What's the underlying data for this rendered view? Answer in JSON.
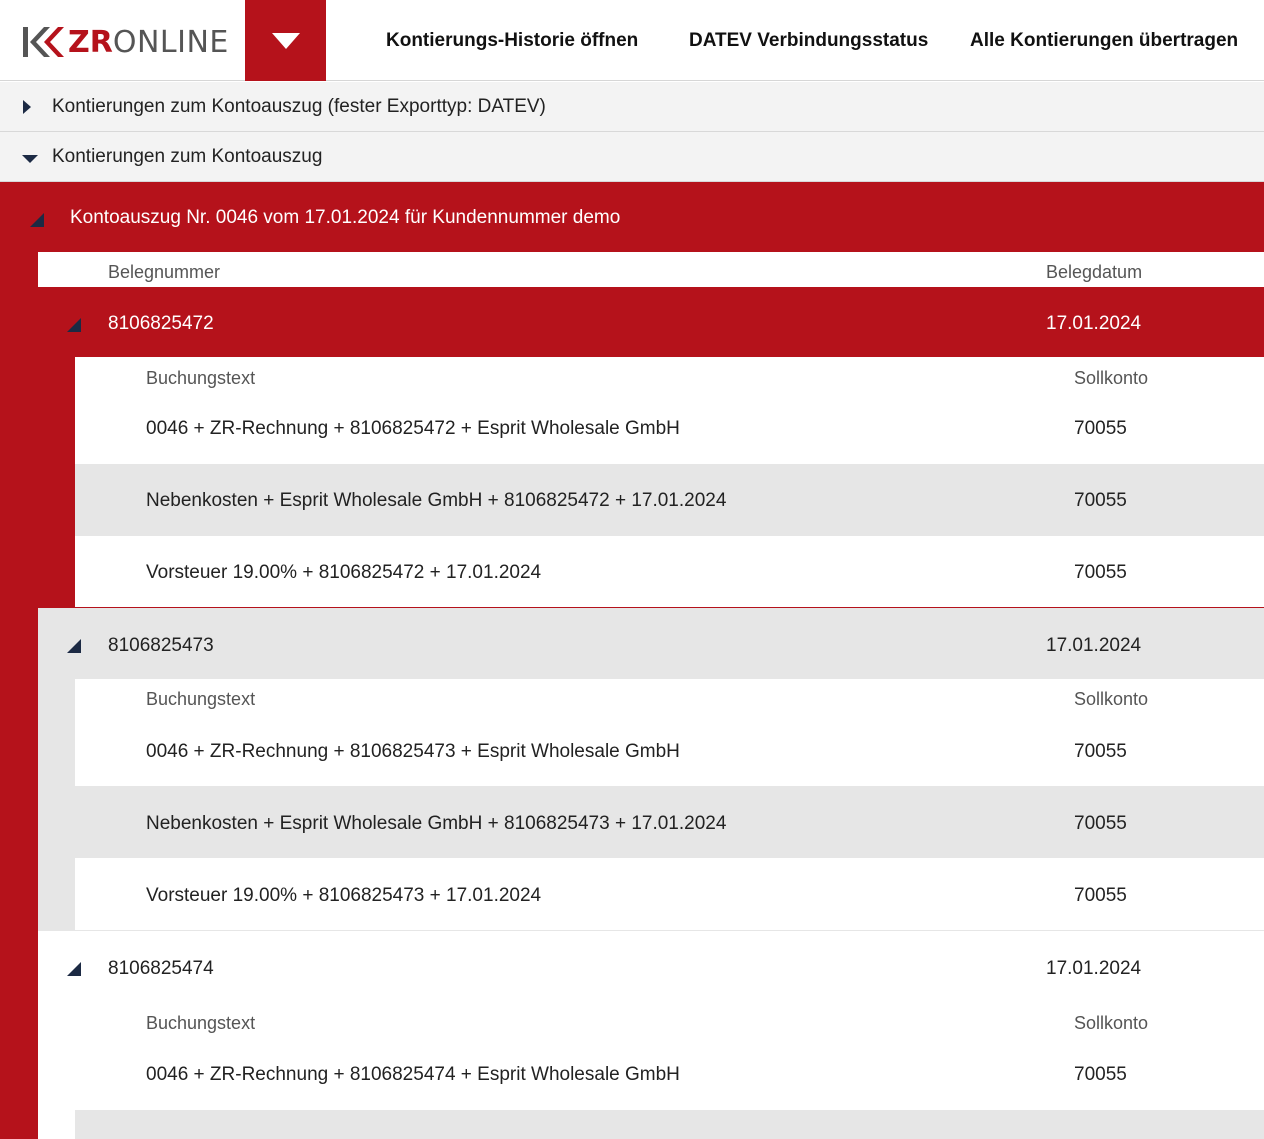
{
  "header": {
    "logo_zr": "ZR",
    "logo_online": "ONLINE",
    "nav": [
      {
        "label": "Kontierungs-Historie öffnen"
      },
      {
        "label": "DATEV Verbindungsstatus"
      },
      {
        "label": "Alle Kontierungen übertragen"
      }
    ]
  },
  "accordions": [
    {
      "label": "Kontierungen zum Kontoauszug (fester Exporttyp: DATEV)"
    },
    {
      "label": "Kontierungen zum Kontoauszug"
    }
  ],
  "statement": {
    "title": "Kontoauszug Nr. 0046 vom 17.01.2024 für Kundennummer demo",
    "columns": {
      "belegnummer": "Belegnummer",
      "belegdatum": "Belegdatum"
    },
    "sub_columns": {
      "buchungstext": "Buchungstext",
      "sollkonto": "Sollkonto"
    },
    "documents": [
      {
        "number": "8106825472",
        "date": "17.01.2024",
        "entries": [
          {
            "text": "0046 + ZR-Rechnung + 8106825472 + Esprit Wholesale GmbH",
            "account": "70055"
          },
          {
            "text": "Nebenkosten + Esprit Wholesale GmbH + 8106825472 + 17.01.2024",
            "account": "70055"
          },
          {
            "text": "Vorsteuer 19.00% + 8106825472 + 17.01.2024",
            "account": "70055"
          }
        ]
      },
      {
        "number": "8106825473",
        "date": "17.01.2024",
        "entries": [
          {
            "text": "0046 + ZR-Rechnung + 8106825473 + Esprit Wholesale GmbH",
            "account": "70055"
          },
          {
            "text": "Nebenkosten + Esprit Wholesale GmbH + 8106825473 + 17.01.2024",
            "account": "70055"
          },
          {
            "text": "Vorsteuer 19.00% + 8106825473 + 17.01.2024",
            "account": "70055"
          }
        ]
      },
      {
        "number": "8106825474",
        "date": "17.01.2024",
        "entries": [
          {
            "text": "0046 + ZR-Rechnung + 8106825474 + Esprit Wholesale GmbH",
            "account": "70055"
          }
        ]
      }
    ]
  },
  "colors": {
    "brand_red": "#b5121b",
    "row_grey": "#e6e6e6",
    "accordion_bg": "#f3f3f3",
    "icon_navy": "#1c2a44"
  }
}
